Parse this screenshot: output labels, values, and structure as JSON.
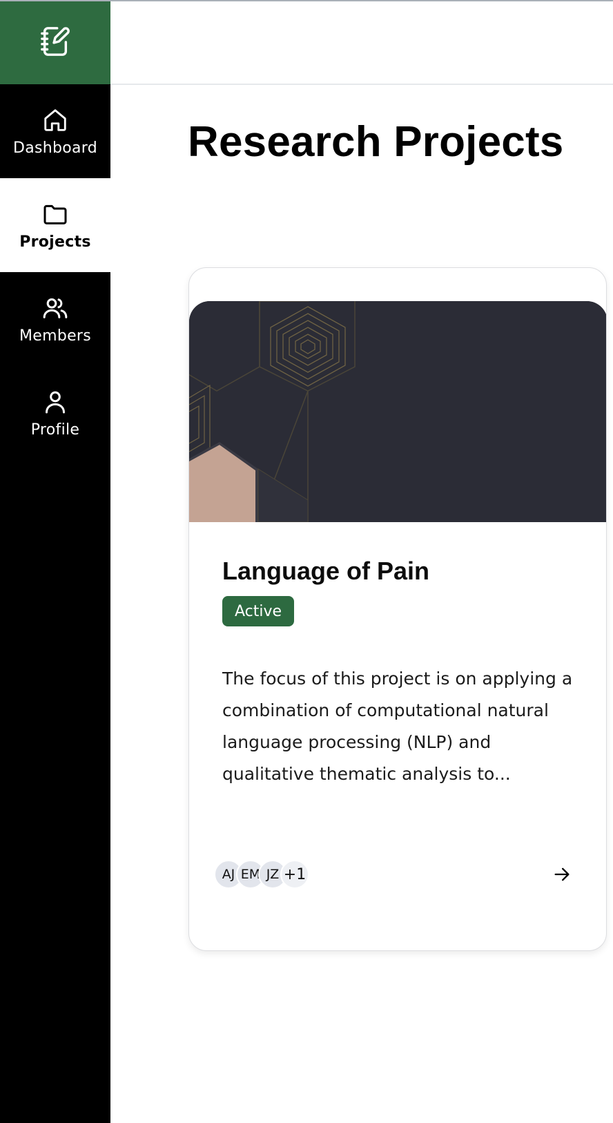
{
  "app": {
    "logo_icon": "notebook-edit-icon",
    "accent_color": "#2e6b40"
  },
  "sidebar": {
    "items": [
      {
        "label": "Dashboard",
        "icon": "home-icon",
        "active": false
      },
      {
        "label": "Projects",
        "icon": "folder-icon",
        "active": true
      },
      {
        "label": "Members",
        "icon": "users-icon",
        "active": false
      },
      {
        "label": "Profile",
        "icon": "user-icon",
        "active": false
      }
    ]
  },
  "main": {
    "title": "Research Projects",
    "projects": [
      {
        "title": "Language of Pain",
        "status": "Active",
        "status_color": "#2d6a40",
        "description": "The focus of this project is on applying a combination of computational natural language processing (NLP) and qualitative thematic analysis to...",
        "members": [
          "AJ",
          "EM",
          "JZ"
        ],
        "members_more": "+1",
        "open_icon": "arrow-right-icon"
      }
    ]
  }
}
